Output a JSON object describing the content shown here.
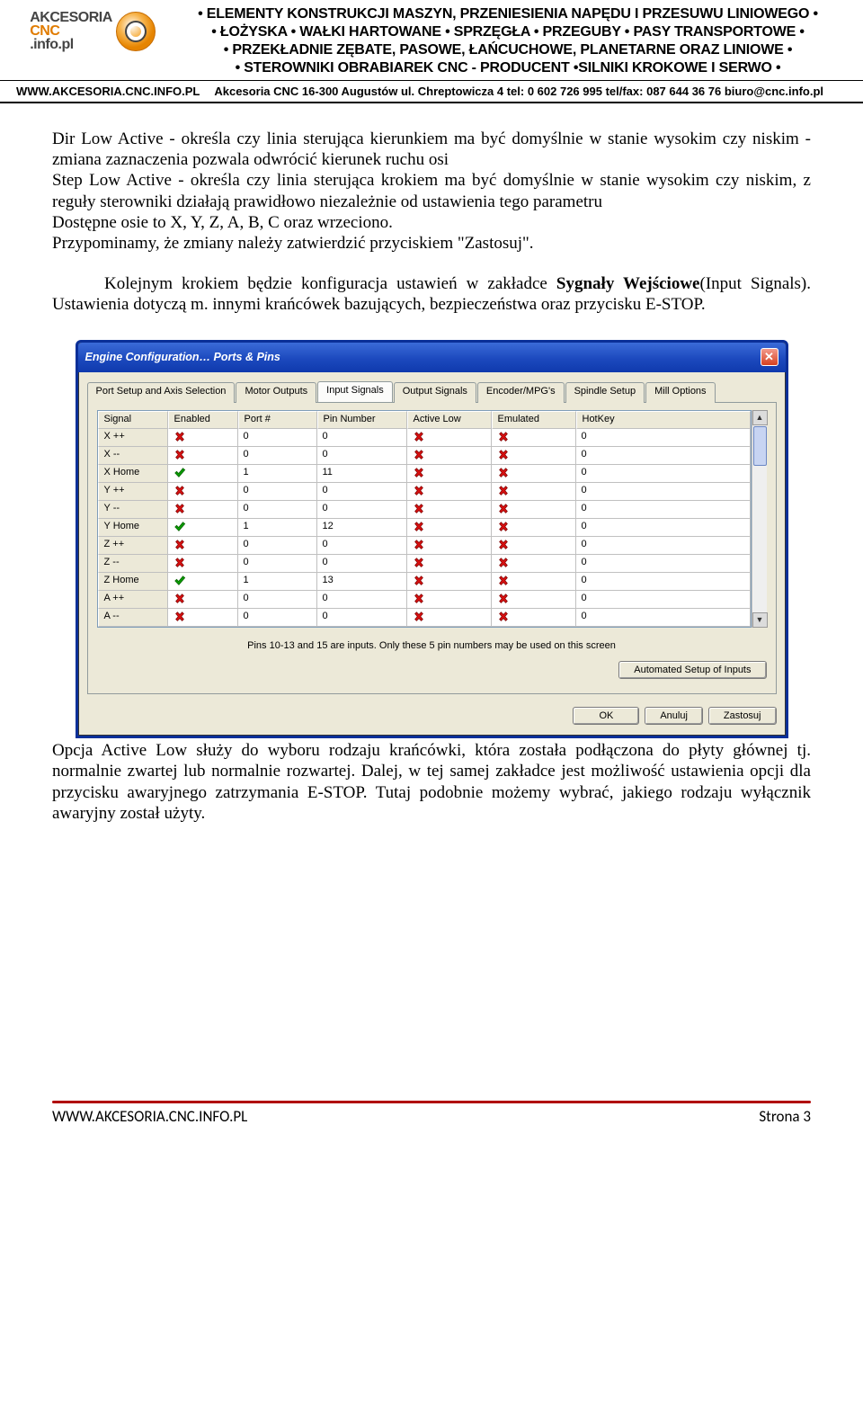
{
  "banner": {
    "logo_top": "AKCESORIA",
    "logo_sub": ".info.pl",
    "logo_cnc": "CNC",
    "desc_l1": "• ELEMENTY KONSTRUKCJI MASZYN, PRZENIESIENIA NAPĘDU I PRZESUWU LINIOWEGO •",
    "desc_l2": "• ŁOŻYSKA • WAŁKI HARTOWANE • SPRZĘGŁA • PRZEGUBY •  PASY TRANSPORTOWE •",
    "desc_l3": "• PRZEKŁADNIE ZĘBATE, PASOWE, ŁAŃCUCHOWE, PLANETARNE ORAZ LINIOWE •",
    "desc_l4": "• STEROWNIKI OBRABIAREK CNC - PRODUCENT •SILNIKI KROKOWE I SERWO •"
  },
  "contact": {
    "url_label": "WWW.AKCESORIA.CNC.INFO.PL",
    "addr": "Akcesoria CNC  16-300 Augustów  ul. Chreptowicza 4    tel: 0 602 726 995 tel/fax: 087 644 36 76  biuro@cnc.info.pl"
  },
  "body": {
    "p1": "Dir Low Active - określa czy linia sterująca kierunkiem ma być domyślnie w stanie wysokim czy niskim -zmiana zaznaczenia pozwala odwrócić kierunek ruchu osi",
    "p2": "Step Low Active - określa czy linia sterująca krokiem ma być domyślnie w stanie wysokim czy niskim, z reguły sterowniki działają prawidłowo niezależnie od ustawienia tego parametru",
    "p3": "Dostępne osie to X, Y, Z, A, B, C oraz wrzeciono.",
    "p4": "Przypominamy, że zmiany należy zatwierdzić przyciskiem \"Zastosuj\".",
    "p5a": "Kolejnym krokiem będzie konfiguracja ustawień w zakładce ",
    "p5b": "Sygnały Wejściowe",
    "p5c": "(Input Signals). Ustawienia dotyczą m. innymi krańcówek bazujących, bezpieczeństwa oraz przycisku E-STOP.",
    "p6": "Opcja Active Low służy do wyboru rodzaju krańcówki, która została podłączona do płyty głównej tj. normalnie zwartej lub normalnie rozwartej. Dalej, w tej samej zakładce jest możliwość ustawienia opcji dla przycisku awaryjnego zatrzymania E-STOP. Tutaj podobnie możemy wybrać, jakiego rodzaju wyłącznik awaryjny został użyty."
  },
  "dialog": {
    "title": "Engine Configuration… Ports & Pins",
    "tabs": [
      "Port Setup and Axis Selection",
      "Motor Outputs",
      "Input Signals",
      "Output Signals",
      "Encoder/MPG's",
      "Spindle Setup",
      "Mill Options"
    ],
    "active_tab": 2,
    "columns": [
      "Signal",
      "Enabled",
      "Port #",
      "Pin Number",
      "Active Low",
      "Emulated",
      "HotKey"
    ],
    "rows": [
      {
        "signal": "X ++",
        "enabled": false,
        "port": "0",
        "pin": "0",
        "activelow": false,
        "emulated": false,
        "hotkey": "0"
      },
      {
        "signal": "X --",
        "enabled": false,
        "port": "0",
        "pin": "0",
        "activelow": false,
        "emulated": false,
        "hotkey": "0"
      },
      {
        "signal": "X Home",
        "enabled": true,
        "port": "1",
        "pin": "11",
        "activelow": false,
        "emulated": false,
        "hotkey": "0"
      },
      {
        "signal": "Y ++",
        "enabled": false,
        "port": "0",
        "pin": "0",
        "activelow": false,
        "emulated": false,
        "hotkey": "0"
      },
      {
        "signal": "Y --",
        "enabled": false,
        "port": "0",
        "pin": "0",
        "activelow": false,
        "emulated": false,
        "hotkey": "0"
      },
      {
        "signal": "Y Home",
        "enabled": true,
        "port": "1",
        "pin": "12",
        "activelow": false,
        "emulated": false,
        "hotkey": "0"
      },
      {
        "signal": "Z ++",
        "enabled": false,
        "port": "0",
        "pin": "0",
        "activelow": false,
        "emulated": false,
        "hotkey": "0"
      },
      {
        "signal": "Z --",
        "enabled": false,
        "port": "0",
        "pin": "0",
        "activelow": false,
        "emulated": false,
        "hotkey": "0"
      },
      {
        "signal": "Z Home",
        "enabled": true,
        "port": "1",
        "pin": "13",
        "activelow": false,
        "emulated": false,
        "hotkey": "0"
      },
      {
        "signal": "A ++",
        "enabled": false,
        "port": "0",
        "pin": "0",
        "activelow": false,
        "emulated": false,
        "hotkey": "0"
      },
      {
        "signal": "A --",
        "enabled": false,
        "port": "0",
        "pin": "0",
        "activelow": false,
        "emulated": false,
        "hotkey": "0"
      }
    ],
    "hint": "Pins 10-13 and 15 are inputs. Only these 5 pin numbers may be used on this screen",
    "auto_btn": "Automated Setup of Inputs",
    "ok": "OK",
    "cancel": "Anuluj",
    "apply": "Zastosuj"
  },
  "footer": {
    "url": "WWW.AKCESORIA.CNC.INFO.PL",
    "page": "Strona 3"
  },
  "glyph": {
    "check": "✔",
    "cross": "✘",
    "x": "✕",
    "up": "▲",
    "down": "▼"
  }
}
